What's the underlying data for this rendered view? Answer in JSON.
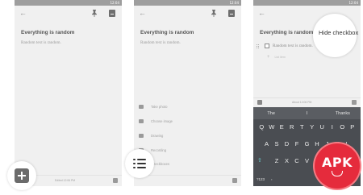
{
  "status_time": "12:04",
  "panels": [
    {
      "note": {
        "title": "Everything is random",
        "body": "Random text is random."
      },
      "bottom": {
        "edited": "Edited 12:06 PM"
      }
    },
    {
      "note": {
        "title": "Everything is random",
        "body": "Random text is random."
      },
      "menu": [
        {
          "label": "Take photo",
          "icon": "camera-icon"
        },
        {
          "label": "Choose image",
          "icon": "image-icon"
        },
        {
          "label": "Drawing",
          "icon": "pen-icon"
        },
        {
          "label": "Recording",
          "icon": "mic-icon"
        },
        {
          "label": "Checkboxes",
          "icon": "checklist-icon"
        }
      ],
      "bottom": {
        "edited": ""
      }
    },
    {
      "note": {
        "title": "Everything is random"
      },
      "checklist": {
        "item": "Random text is random.",
        "add_label": "List item"
      },
      "menu_popup": {
        "label": "Hide checkbox"
      },
      "bottom": {
        "edited": "About 12:06 PM"
      },
      "keyboard": {
        "suggestions": [
          "The",
          "I",
          "Thanks"
        ],
        "row1": [
          "Q",
          "W",
          "E",
          "R",
          "T",
          "Y",
          "U",
          "I",
          "O",
          "P"
        ],
        "row2": [
          "A",
          "S",
          "D",
          "F",
          "G",
          "H",
          "J",
          "K",
          "L"
        ],
        "row3": [
          "Z",
          "X",
          "C",
          "V",
          "B",
          "N",
          "M"
        ],
        "mode_key": "?123",
        "comma_key": ","
      }
    }
  ],
  "watermark": {
    "text": "APK"
  }
}
